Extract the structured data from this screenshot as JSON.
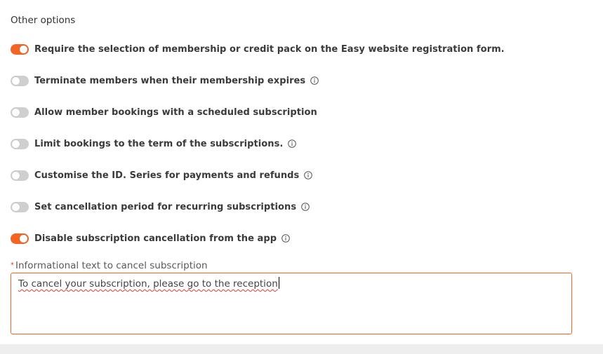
{
  "section": {
    "title": "Other options"
  },
  "options": [
    {
      "label": "Require the selection of membership or credit pack on the Easy website registration form.",
      "enabled": true,
      "has_info": false
    },
    {
      "label": "Terminate members when their membership expires",
      "enabled": false,
      "has_info": true
    },
    {
      "label": "Allow member bookings with a scheduled subscription",
      "enabled": false,
      "has_info": false
    },
    {
      "label": "Limit bookings to the term of the subscriptions.",
      "enabled": false,
      "has_info": true
    },
    {
      "label": "Customise the ID. Series for payments and refunds",
      "enabled": false,
      "has_info": true
    },
    {
      "label": "Set cancellation period for recurring subscriptions",
      "enabled": false,
      "has_info": true
    },
    {
      "label": "Disable subscription cancellation from the app",
      "enabled": true,
      "has_info": true
    }
  ],
  "cancel_text_field": {
    "required_marker": "*",
    "label": "Informational text to cancel subscription",
    "value": "To cancel your subscription, please go to the reception"
  },
  "colors": {
    "accent": "#f26522",
    "toggle_off": "#cfcfcf",
    "required": "#e53935"
  }
}
